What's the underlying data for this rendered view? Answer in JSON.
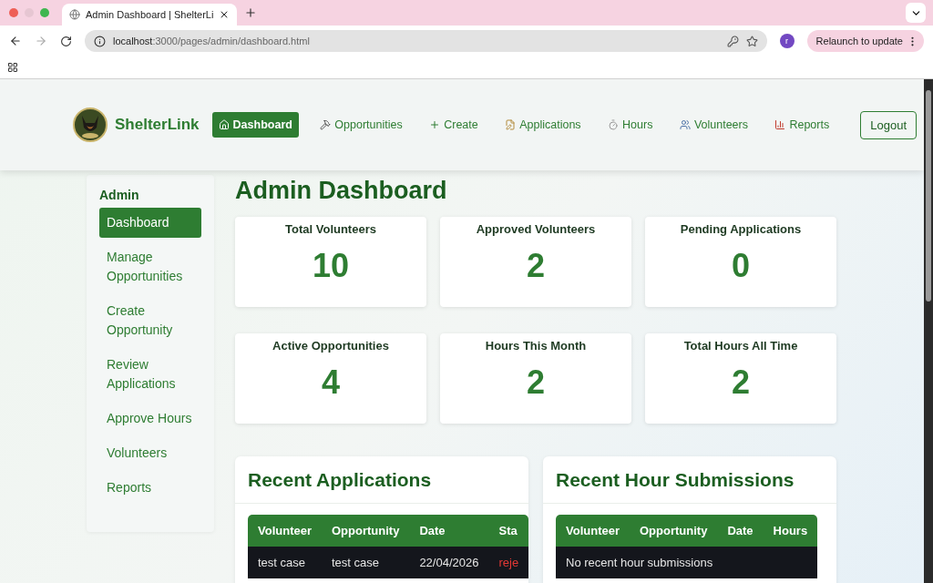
{
  "browser": {
    "tab_title": "Admin Dashboard | ShelterLi",
    "url_host": "localhost",
    "url_path": ":3000/pages/admin/dashboard.html",
    "avatar": "r",
    "relaunch": "Relaunch to update"
  },
  "header": {
    "brand": "ShelterLink",
    "nav": [
      {
        "label": "Dashboard",
        "selected": true
      },
      {
        "label": "Opportunities",
        "selected": false
      },
      {
        "label": "Create",
        "selected": false
      },
      {
        "label": "Applications",
        "selected": false
      },
      {
        "label": "Hours",
        "selected": false
      },
      {
        "label": "Volunteers",
        "selected": false
      },
      {
        "label": "Reports",
        "selected": false
      }
    ],
    "logout": "Logout"
  },
  "sidebar": {
    "title": "Admin",
    "items": [
      {
        "label": "Dashboard",
        "selected": true
      },
      {
        "label": "Manage Opportunities",
        "selected": false
      },
      {
        "label": "Create Opportunity",
        "selected": false
      },
      {
        "label": "Review Applications",
        "selected": false
      },
      {
        "label": "Approve Hours",
        "selected": false
      },
      {
        "label": "Volunteers",
        "selected": false
      },
      {
        "label": "Reports",
        "selected": false
      }
    ]
  },
  "page_title": "Admin Dashboard",
  "stats": [
    {
      "label": "Total Volunteers",
      "value": "10"
    },
    {
      "label": "Approved Volunteers",
      "value": "2"
    },
    {
      "label": "Pending Applications",
      "value": "0"
    },
    {
      "label": "Active Opportunities",
      "value": "4"
    },
    {
      "label": "Hours This Month",
      "value": "2"
    },
    {
      "label": "Total Hours All Time",
      "value": "2"
    }
  ],
  "panels": [
    {
      "title": "Recent Applications",
      "columns": [
        "Volunteer",
        "Opportunity",
        "Date",
        "Sta"
      ],
      "rows": [
        [
          "test case",
          "test case",
          "22/04/2026",
          {
            "text": "reje",
            "kind": "status"
          }
        ]
      ]
    },
    {
      "title": "Recent Hour Submissions",
      "columns": [
        "Volunteer",
        "Opportunity",
        "Date",
        "Hours"
      ],
      "empty": "No recent hour submissions"
    }
  ]
}
